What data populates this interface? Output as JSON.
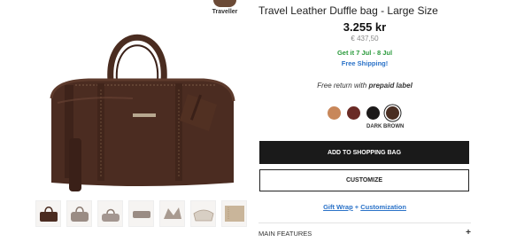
{
  "brand": {
    "name": "Traveller"
  },
  "product": {
    "title": "Travel Leather Duffle bag - Large Size",
    "price": "3.255 kr",
    "price_alt": "€ 437,50",
    "delivery": "Get it 7 Jul - 8 Jul",
    "shipping": "Free Shipping!",
    "return_prefix": "Free return with ",
    "return_bold": "prepaid label"
  },
  "colors": {
    "options": [
      "#c8875a",
      "#6a2a25",
      "#1c1a1a",
      "#4a2e22"
    ],
    "selected_label": "DARK BROWN"
  },
  "actions": {
    "add_to_bag": "ADD TO SHOPPING BAG",
    "customize": "CUSTOMIZE"
  },
  "extras": {
    "gift_wrap": "Gift Wrap",
    "plus": "+",
    "customization": "Customization"
  },
  "sections": {
    "main_features": "MAIN FEATURES",
    "expand_symbol": "+"
  },
  "thumbnails": [
    "bag-front",
    "bag-side",
    "bag-top",
    "bag-flat",
    "bag-open",
    "bag-interior",
    "bag-detail"
  ]
}
